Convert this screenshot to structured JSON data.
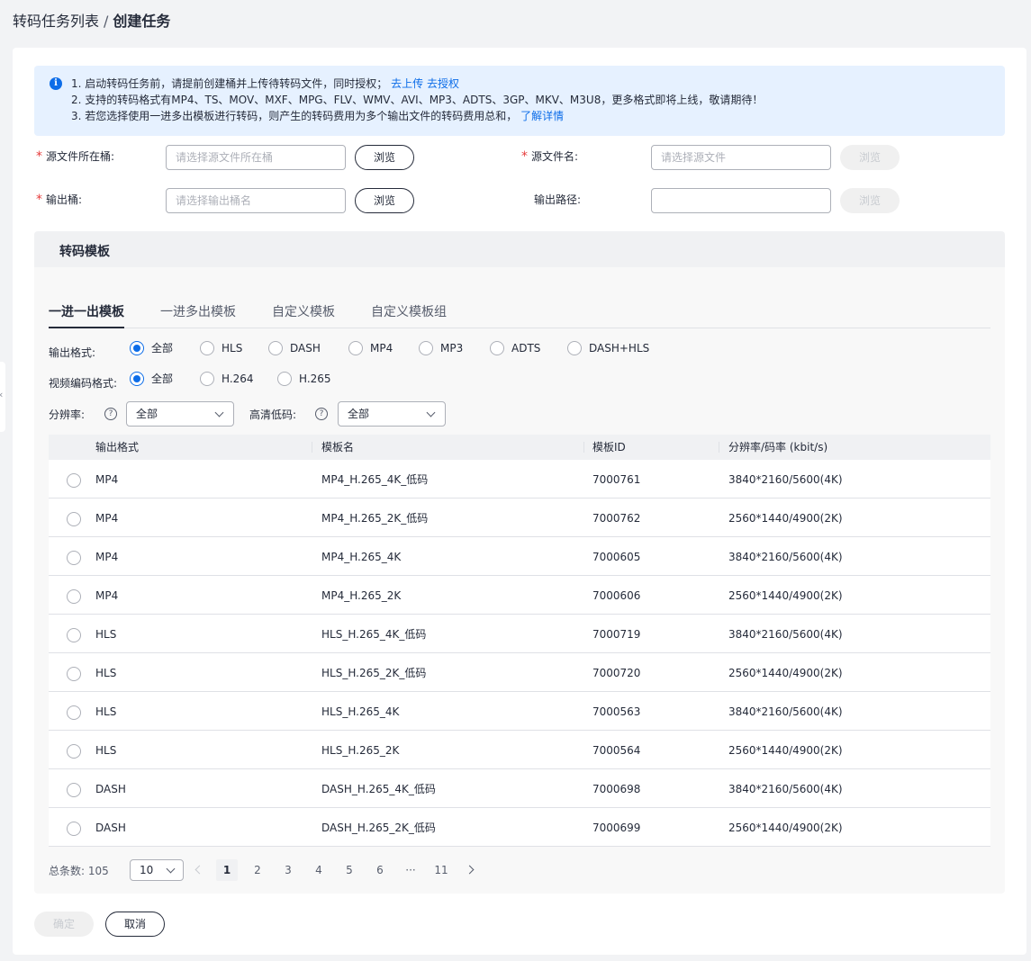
{
  "breadcrumb": {
    "parent": "转码任务列表",
    "separator": "/",
    "current": "创建任务"
  },
  "notice": {
    "line1_text": "1. 启动转码任务前，请提前创建桶并上传待转码文件，同时授权；",
    "line1_link_upload": "去上传",
    "line1_link_auth": "去授权",
    "line2_text": "2. 支持的转码格式有MP4、TS、MOV、MXF、MPG、FLV、WMV、AVI、MP3、ADTS、3GP、MKV、M3U8，更多格式即将上线，敬请期待！",
    "line3_text": "3. 若您选择使用一进多出模板进行转码，则产生的转码费用为多个输出文件的转码费用总和，",
    "line3_link": "了解详情"
  },
  "form": {
    "source_bucket": {
      "label": "源文件所在桶:",
      "placeholder": "请选择源文件所在桶",
      "button": "浏览"
    },
    "source_file": {
      "label": "源文件名:",
      "placeholder": "请选择源文件",
      "button": "浏览"
    },
    "output_bucket": {
      "label": "输出桶:",
      "placeholder": "请选择输出桶名",
      "button": "浏览"
    },
    "output_path": {
      "label": "输出路径:",
      "placeholder": "",
      "button": "浏览"
    },
    "required_mark": "*"
  },
  "template_panel": {
    "title": "转码模板",
    "tabs": [
      "一进一出模板",
      "一进多出模板",
      "自定义模板",
      "自定义模板组"
    ],
    "output_format": {
      "label": "输出格式:",
      "options": [
        "全部",
        "HLS",
        "DASH",
        "MP4",
        "MP3",
        "ADTS",
        "DASH+HLS"
      ],
      "selected": "全部"
    },
    "video_codec": {
      "label": "视频编码格式:",
      "options": [
        "全部",
        "H.264",
        "H.265"
      ],
      "selected": "全部"
    },
    "resolution": {
      "label": "分辨率:",
      "help": "?",
      "value": "全部"
    },
    "hd_low_bitrate": {
      "label": "高清低码:",
      "help": "?",
      "value": "全部"
    }
  },
  "table": {
    "headers": [
      "输出格式",
      "模板名",
      "模板ID",
      "分辨率/码率 (kbit/s)"
    ],
    "rows": [
      [
        "MP4",
        "MP4_H.265_4K_低码",
        "7000761",
        "3840*2160/5600(4K)"
      ],
      [
        "MP4",
        "MP4_H.265_2K_低码",
        "7000762",
        "2560*1440/4900(2K)"
      ],
      [
        "MP4",
        "MP4_H.265_4K",
        "7000605",
        "3840*2160/5600(4K)"
      ],
      [
        "MP4",
        "MP4_H.265_2K",
        "7000606",
        "2560*1440/4900(2K)"
      ],
      [
        "HLS",
        "HLS_H.265_4K_低码",
        "7000719",
        "3840*2160/5600(4K)"
      ],
      [
        "HLS",
        "HLS_H.265_2K_低码",
        "7000720",
        "2560*1440/4900(2K)"
      ],
      [
        "HLS",
        "HLS_H.265_4K",
        "7000563",
        "3840*2160/5600(4K)"
      ],
      [
        "HLS",
        "HLS_H.265_2K",
        "7000564",
        "2560*1440/4900(2K)"
      ],
      [
        "DASH",
        "DASH_H.265_4K_低码",
        "7000698",
        "3840*2160/5600(4K)"
      ],
      [
        "DASH",
        "DASH_H.265_2K_低码",
        "7000699",
        "2560*1440/4900(2K)"
      ]
    ]
  },
  "pagination": {
    "total_label": "总条数:",
    "total": "105",
    "page_size": "10",
    "pages": [
      "1",
      "2",
      "3",
      "4",
      "5",
      "6",
      "···",
      "11"
    ],
    "current": "1"
  },
  "actions": {
    "confirm": "确定",
    "cancel": "取消"
  },
  "colors": {
    "accent": "#0d6de8",
    "required": "#e63c3c",
    "notice_bg": "#e6f1ff"
  }
}
